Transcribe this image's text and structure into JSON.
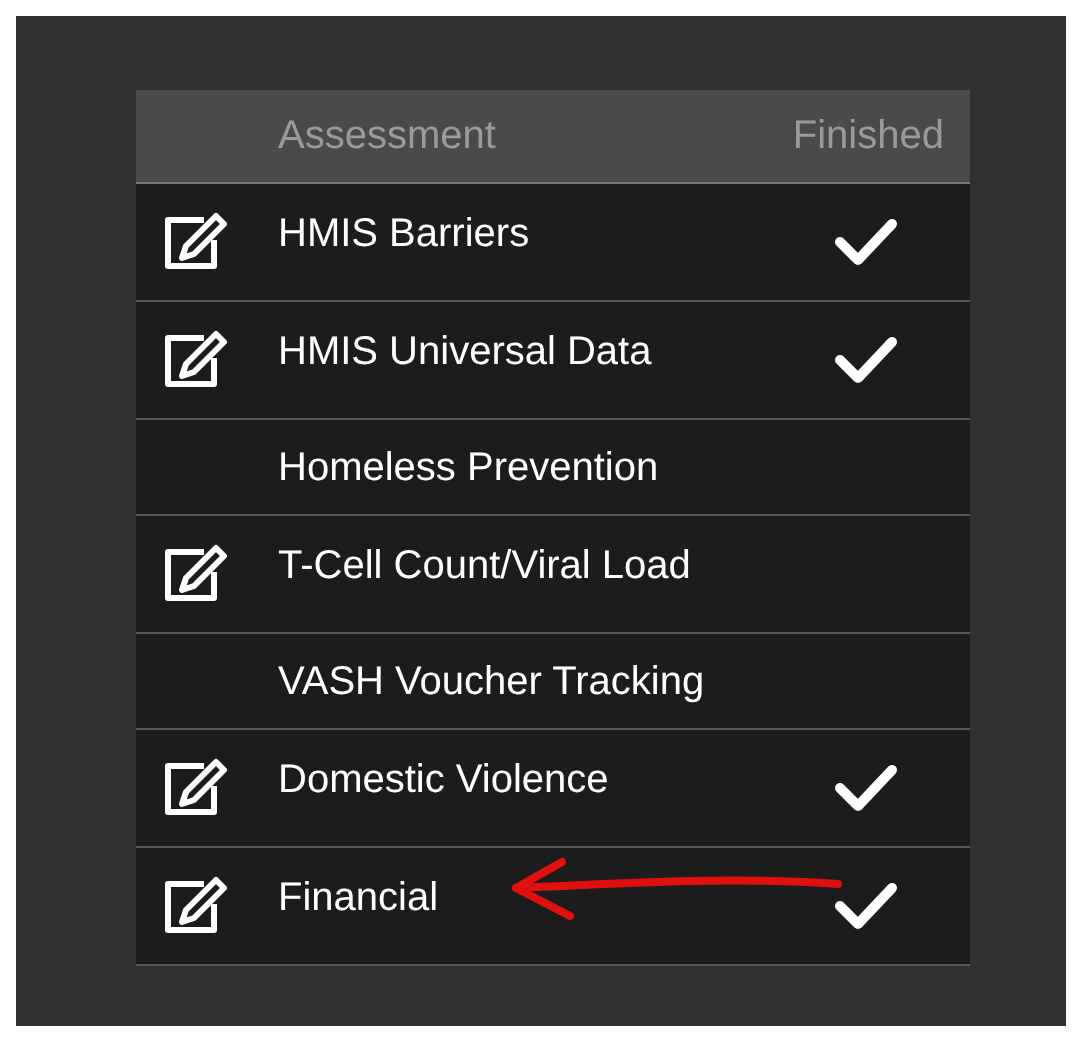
{
  "table": {
    "columns": [
      "Assessment",
      "Finished"
    ],
    "rows": [
      {
        "name": "HMIS Barriers",
        "editable": true,
        "finished": true
      },
      {
        "name": "HMIS Universal Data",
        "editable": true,
        "finished": true
      },
      {
        "name": "Homeless Prevention",
        "editable": false,
        "finished": false
      },
      {
        "name": "T-Cell Count/Viral Load",
        "editable": true,
        "finished": false
      },
      {
        "name": "VASH Voucher Tracking",
        "editable": false,
        "finished": false
      },
      {
        "name": "Domestic Violence",
        "editable": true,
        "finished": true
      },
      {
        "name": "Financial",
        "editable": true,
        "finished": true
      }
    ]
  },
  "annotation": {
    "kind": "arrow"
  }
}
